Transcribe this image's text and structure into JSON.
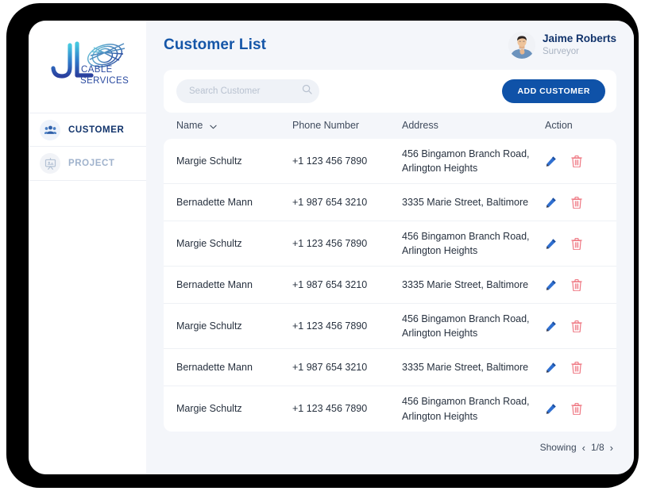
{
  "brand": {
    "logo_letters": "JL",
    "logo_line1": "CABLE",
    "logo_line2": "SERVICES",
    "accent_blue": "#1556a8",
    "accent_dark": "#11336b",
    "button_blue": "#0f52a8",
    "edit_icon_color": "#2f6fd0",
    "delete_icon_color": "#ef7a85"
  },
  "sidebar": {
    "items": [
      {
        "label": "CUSTOMER",
        "icon": "people-icon",
        "active": true
      },
      {
        "label": "PROJECT",
        "icon": "presentation-board-icon",
        "active": false
      }
    ]
  },
  "header": {
    "title": "Customer List",
    "user": {
      "name": "Jaime Roberts",
      "role": "Surveyor",
      "avatar": "user-avatar-photo"
    }
  },
  "toolbar": {
    "search_placeholder": "Search Customer",
    "search_value": "",
    "search_icon": "search-icon",
    "add_label": "ADD CUSTOMER"
  },
  "table": {
    "columns": [
      {
        "key": "name",
        "label": "Name",
        "sort_icon": "chevron-down-icon"
      },
      {
        "key": "phone",
        "label": "Phone Number"
      },
      {
        "key": "address",
        "label": "Address"
      },
      {
        "key": "action",
        "label": "Action"
      }
    ],
    "rows": [
      {
        "name": "Margie Schultz",
        "phone": "+1 123 456 7890",
        "address_line1": "456  Bingamon Branch Road,",
        "address_line2": "Arlington Heights"
      },
      {
        "name": "Bernadette Mann",
        "phone": "+1 987 654 3210",
        "address_line1": "3335  Marie Street, Baltimore",
        "address_line2": ""
      },
      {
        "name": "Margie Schultz",
        "phone": "+1 123 456 7890",
        "address_line1": "456  Bingamon Branch Road,",
        "address_line2": "Arlington Heights"
      },
      {
        "name": "Bernadette Mann",
        "phone": "+1 987 654 3210",
        "address_line1": "3335  Marie Street, Baltimore",
        "address_line2": ""
      },
      {
        "name": "Margie Schultz",
        "phone": "+1 123 456 7890",
        "address_line1": "456  Bingamon Branch Road,",
        "address_line2": "Arlington Heights"
      },
      {
        "name": "Bernadette Mann",
        "phone": "+1 987 654 3210",
        "address_line1": "3335  Marie Street, Baltimore",
        "address_line2": ""
      },
      {
        "name": "Margie Schultz",
        "phone": "+1 123 456 7890",
        "address_line1": "456  Bingamon Branch Road,",
        "address_line2": "Arlington Heights"
      }
    ],
    "row_actions": {
      "edit": "edit-pencil-icon",
      "delete": "trash-icon"
    }
  },
  "pagination": {
    "showing_label": "Showing",
    "prev_icon": "‹",
    "position": "1/8",
    "next_icon": "›"
  }
}
